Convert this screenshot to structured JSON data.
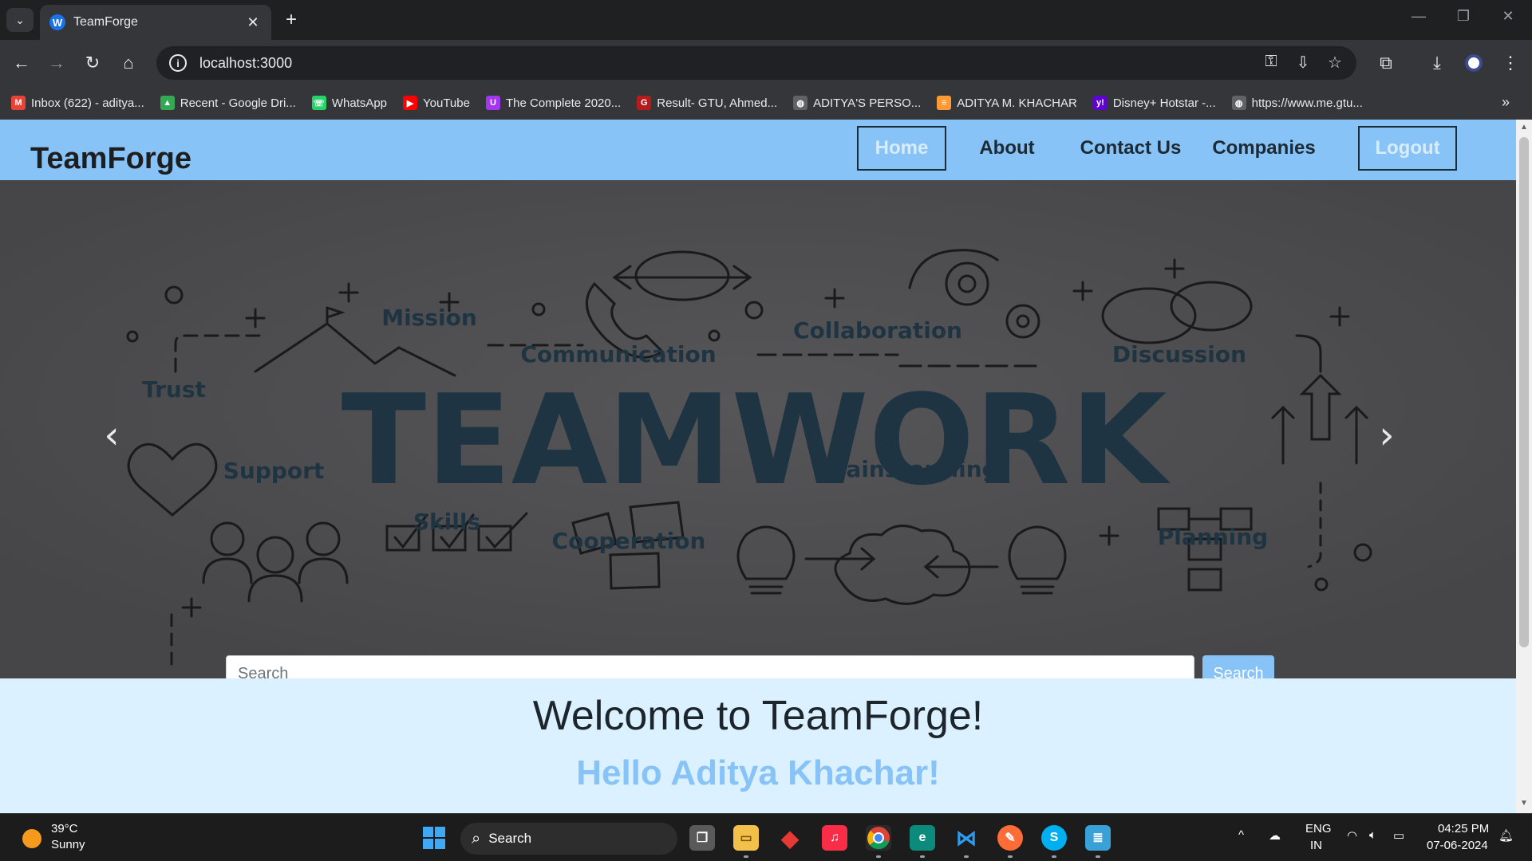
{
  "browser": {
    "tab_title": "TeamForge",
    "url": "localhost:3000",
    "bookmarks": [
      {
        "label": "Inbox (622) - aditya...",
        "icon": "gmail-icon",
        "color": "#ea4335",
        "glyph": "M"
      },
      {
        "label": "Recent - Google Dri...",
        "icon": "google-drive-icon",
        "color": "#34a853",
        "glyph": "▲"
      },
      {
        "label": "WhatsApp",
        "icon": "whatsapp-icon",
        "color": "#25d366",
        "glyph": "☏"
      },
      {
        "label": "YouTube",
        "icon": "youtube-icon",
        "color": "#ff0000",
        "glyph": "▶"
      },
      {
        "label": "The Complete 2020...",
        "icon": "udemy-icon",
        "color": "#a435f0",
        "glyph": "U"
      },
      {
        "label": "Result- GTU, Ahmed...",
        "icon": "gtu-icon",
        "color": "#b71c1c",
        "glyph": "G"
      },
      {
        "label": "ADITYA'S PERSO...",
        "icon": "globe-icon",
        "color": "#5f6368",
        "glyph": "◍"
      },
      {
        "label": "ADITYA M. KHACHAR",
        "icon": "india-flag-icon",
        "color": "#ff9933",
        "glyph": "≡"
      },
      {
        "label": "Disney+ Hotstar -...",
        "icon": "yahoo-icon",
        "color": "#6001d2",
        "glyph": "y!"
      },
      {
        "label": "https://www.me.gtu...",
        "icon": "globe-icon",
        "color": "#5f6368",
        "glyph": "◍"
      }
    ]
  },
  "navbar": {
    "brand": "TeamForge",
    "items": [
      {
        "label": "Home",
        "boxed": true
      },
      {
        "label": "About",
        "boxed": false
      },
      {
        "label": "Contact Us",
        "boxed": false
      },
      {
        "label": "Companies",
        "boxed": false
      },
      {
        "label": "Logout",
        "boxed": true
      }
    ]
  },
  "hero": {
    "main_word": "TEAMWORK",
    "words": [
      "Mission",
      "Communication",
      "Collaboration",
      "Discussion",
      "Trust",
      "Support",
      "Skills",
      "Cooperation",
      "Brainstorming",
      "Planning"
    ],
    "search_placeholder": "Search",
    "search_button": "Search"
  },
  "main": {
    "welcome": "Welcome to TeamForge!",
    "hello": "Hello Aditya Khachar!"
  },
  "taskbar": {
    "weather_temp": "39°C",
    "weather_cond": "Sunny",
    "search_label": "Search",
    "lang_top": "ENG",
    "lang_bottom": "IN",
    "time": "04:25 PM",
    "date": "07-06-2024"
  }
}
